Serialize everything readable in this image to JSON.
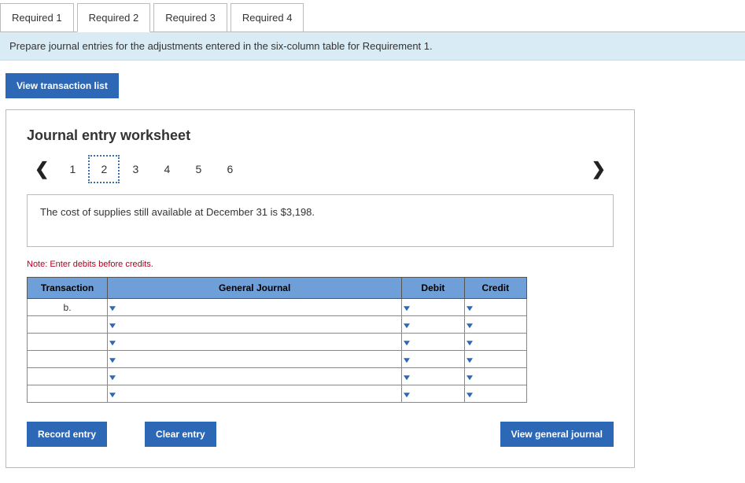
{
  "tabs": {
    "items": [
      "Required 1",
      "Required 2",
      "Required 3",
      "Required 4"
    ],
    "active_index": 1
  },
  "instruction": "Prepare journal entries for the adjustments entered in the six-column table for Requirement 1.",
  "buttons": {
    "view_transaction_list": "View transaction list",
    "record_entry": "Record entry",
    "clear_entry": "Clear entry",
    "view_general_journal": "View general journal"
  },
  "worksheet": {
    "title": "Journal entry worksheet",
    "pager": {
      "items": [
        "1",
        "2",
        "3",
        "4",
        "5",
        "6"
      ],
      "current_index": 1
    },
    "description": "The cost of supplies still available at December 31 is $3,198.",
    "note": "Note: Enter debits before credits.",
    "headers": {
      "transaction": "Transaction",
      "general_journal": "General Journal",
      "debit": "Debit",
      "credit": "Credit"
    },
    "rows": [
      {
        "transaction": "b.",
        "general_journal": "",
        "debit": "",
        "credit": ""
      },
      {
        "transaction": "",
        "general_journal": "",
        "debit": "",
        "credit": ""
      },
      {
        "transaction": "",
        "general_journal": "",
        "debit": "",
        "credit": ""
      },
      {
        "transaction": "",
        "general_journal": "",
        "debit": "",
        "credit": ""
      },
      {
        "transaction": "",
        "general_journal": "",
        "debit": "",
        "credit": ""
      },
      {
        "transaction": "",
        "general_journal": "",
        "debit": "",
        "credit": ""
      }
    ]
  }
}
